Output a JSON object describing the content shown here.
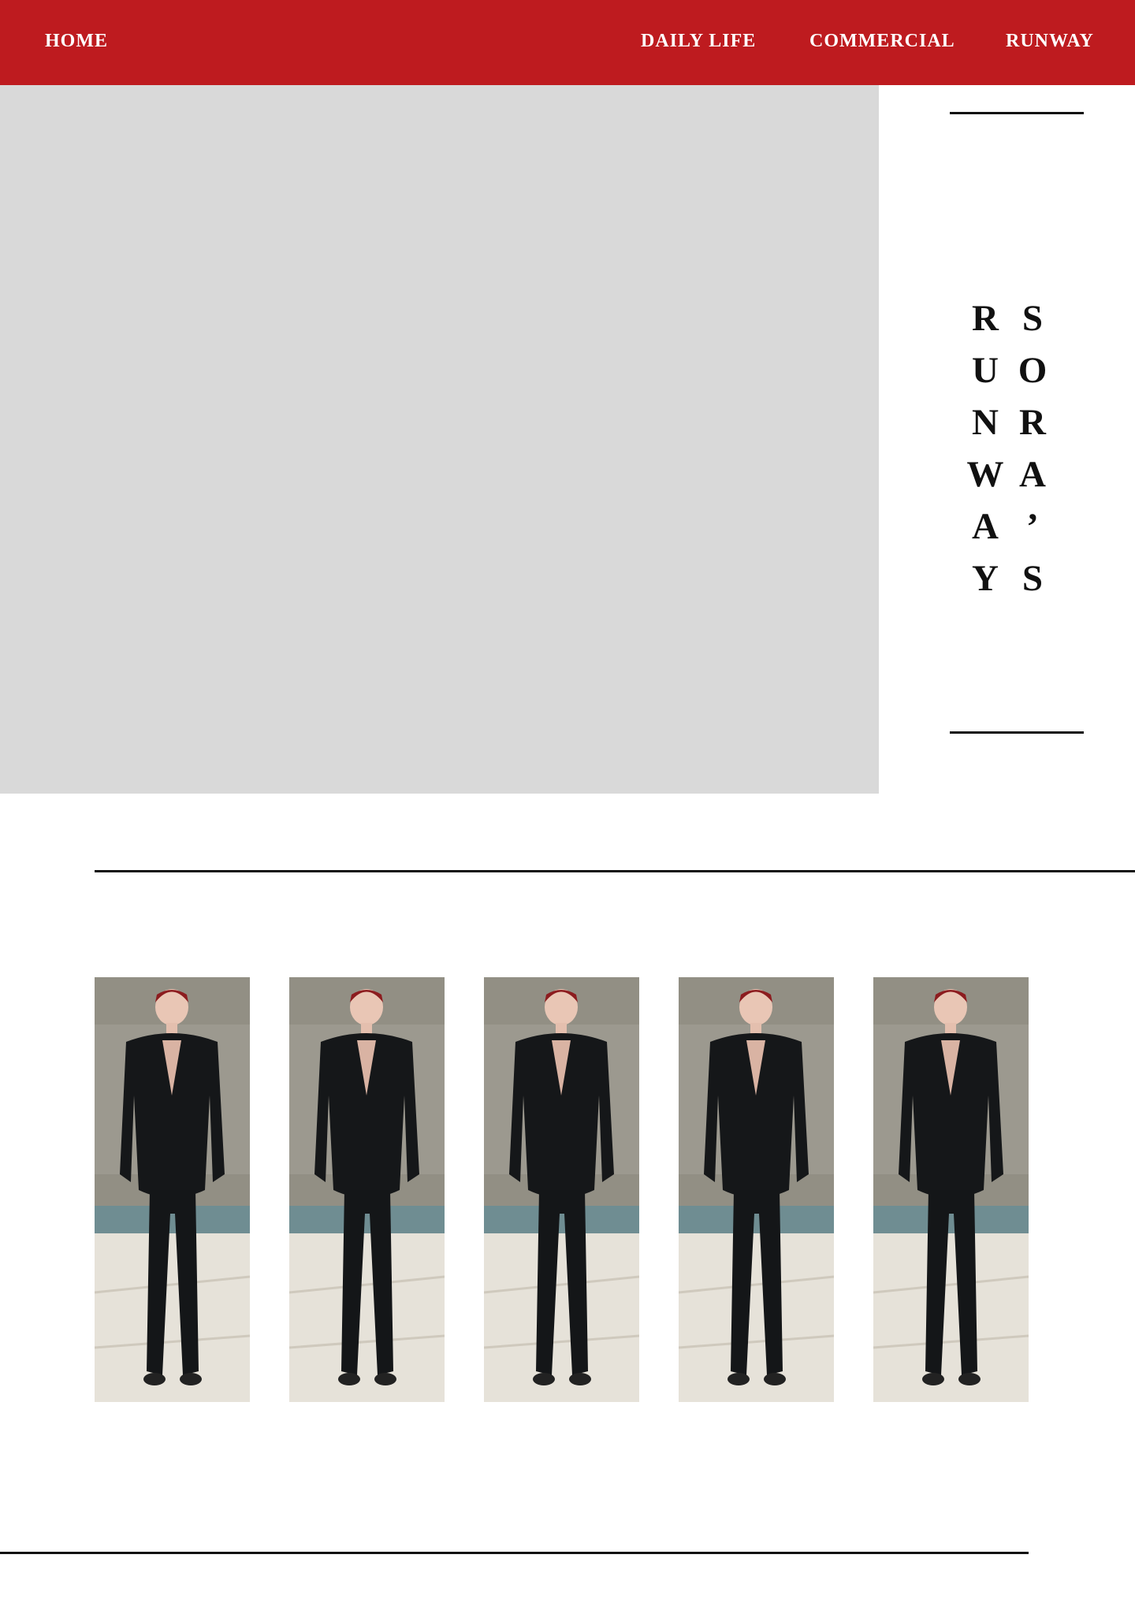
{
  "nav": {
    "home": "HOME",
    "daily_life": "DAILY LIFE",
    "commercial": "COMMERCIAL",
    "runway": "RUNWAY"
  },
  "title": {
    "line1": "SORA’S",
    "line2": "RUNWAY"
  },
  "gallery": {
    "count": 5
  },
  "colors": {
    "nav_bg": "#be1b1f",
    "hero_placeholder": "#d9d9d9",
    "rules": "#111111"
  }
}
